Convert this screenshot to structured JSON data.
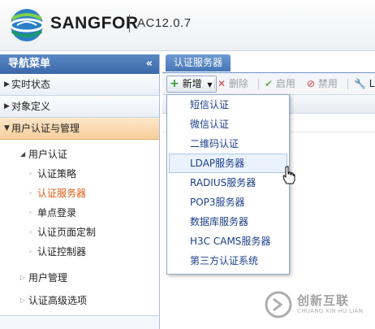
{
  "header": {
    "brand": "SANGFOR",
    "version": "AC12.0.7",
    "brand_color": "#1d1d1d"
  },
  "sidebar": {
    "title": "导航菜单",
    "collapse_glyph": "«",
    "sections": [
      {
        "label": "实时状态",
        "expanded": false
      },
      {
        "label": "对象定义",
        "expanded": false
      },
      {
        "label": "用户认证与管理",
        "expanded": true
      }
    ],
    "tree": {
      "group_label": "用户认证",
      "children": [
        {
          "label": "认证策略",
          "selected": false
        },
        {
          "label": "认证服务器",
          "selected": true
        },
        {
          "label": "单点登录",
          "selected": false
        },
        {
          "label": "认证页面定制",
          "selected": false
        },
        {
          "label": "认证控制器",
          "selected": false
        }
      ],
      "other_groups": [
        {
          "label": "用户管理"
        },
        {
          "label": "认证高级选项"
        }
      ]
    },
    "active_color": "#f7cf9c"
  },
  "main": {
    "tab_label": "认证服务器",
    "toolbar": {
      "add_label": "新增",
      "delete_label": "删除",
      "enable_label": "启用",
      "disable_label": "禁用",
      "ldap_truncated": "L"
    }
  },
  "dropdown": {
    "items": [
      "短信认证",
      "微信认证",
      "二维码认证",
      "LDAP服务器",
      "RADIUS服务器",
      "POP3服务器",
      "数据库服务器",
      "H3C CAMS服务器",
      "第三方认证系统"
    ],
    "hover_index": 3
  },
  "watermark": {
    "text": "创新互联",
    "sub": "CHUANG XIN HU LIAN"
  }
}
